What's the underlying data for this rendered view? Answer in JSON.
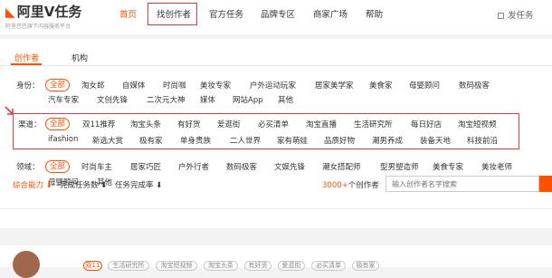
{
  "brand": {
    "name": "阿里V任务",
    "tagline": "阿里巴巴旗下内容服务平台"
  },
  "nav": {
    "items": [
      "首页",
      "找创作者",
      "官方任务",
      "品牌专区",
      "商家广场",
      "帮助"
    ],
    "publish": "发任务"
  },
  "tabs": [
    "创作者",
    "机构"
  ],
  "filters": {
    "identity": {
      "label": "身份：",
      "options": [
        "全部",
        "淘女郎",
        "自媒体",
        "时尚咖",
        "美妆专家",
        "户外运动玩家",
        "居家美学家",
        "美食家",
        "母婴顾问",
        "数码极客",
        "汽车专家",
        "文创先锋",
        "二次元大神",
        "媒体",
        "网站App",
        "其他"
      ]
    },
    "channel": {
      "label": "渠道：",
      "options": [
        "全部",
        "双11推荐",
        "淘宝头条",
        "有好货",
        "爱逛街",
        "必买清单",
        "淘宝直播",
        "生活研究所",
        "每日好店",
        "淘宝短视频",
        "ifashion",
        "新选大赏",
        "极有家",
        "单身贵族",
        "二人世界",
        "家有萌娃",
        "品质好物",
        "潮男养成",
        "装备天地",
        "科技前沿"
      ]
    },
    "field": {
      "label": "领域：",
      "options": [
        "全部",
        "时尚车主",
        "居家巧匠",
        "户外行者",
        "数码极客",
        "文娱先锋",
        "潮女搭配师",
        "型男塑造师",
        "美食专家",
        "美妆老师",
        "母婴顾问",
        "其他"
      ]
    }
  },
  "sort": {
    "items": [
      "综合能力",
      "完成任务数",
      "任务完成率"
    ],
    "arrow": "⬇"
  },
  "results": {
    "count": "3000+",
    "suffix": "个创作者"
  },
  "search": {
    "placeholder": "输入创作者名字搜索"
  },
  "card": {
    "tags": [
      "双11",
      "生活研究所",
      "淘宝短视频",
      "淘宝头条",
      "有好货",
      "爱逛街",
      "必买清单",
      "极有家"
    ]
  },
  "colors": {
    "accent": "#ff5000",
    "highlight": "#e03c3c"
  }
}
